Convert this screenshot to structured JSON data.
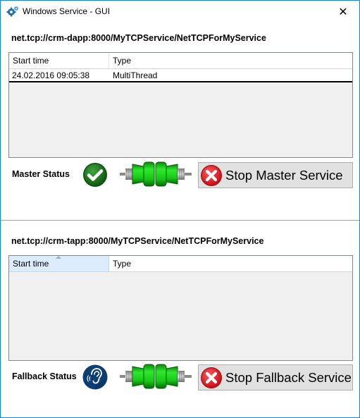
{
  "window": {
    "title": "Windows Service - GUI",
    "app_icon": "gears-icon",
    "close_label": "✕",
    "border_color": "#1883d7"
  },
  "master": {
    "endpoint": "net.tcp://crm-dapp:8000/MyTCPService/NetTCPForMyService",
    "columns": [
      "Start time",
      "Type"
    ],
    "rows": [
      {
        "start_time": "24.02.2016 09:05:38",
        "type": "MultiThread"
      }
    ],
    "status_label": "Master Status",
    "status_icon": "checkmark-icon",
    "connection_icon": "connected-plug-icon",
    "stop_button_label": "Stop Master Service",
    "stop_icon": "red-x-icon"
  },
  "fallback": {
    "endpoint": "net.tcp://crm-tapp:8000/MyTCPService/NetTCPForMyService",
    "columns": [
      "Start time",
      "Type"
    ],
    "sorted_column": "Start time",
    "rows": [],
    "status_label": "Fallback Status",
    "status_icon": "listening-ear-icon",
    "connection_icon": "connected-plug-icon",
    "stop_button_label": "Stop Fallback Service",
    "stop_icon": "red-x-icon"
  },
  "colors": {
    "status_ok": "#1f7a1f",
    "status_listening": "#0b3f73",
    "connector_green": "#11c511",
    "stop_red": "#e0252b"
  }
}
